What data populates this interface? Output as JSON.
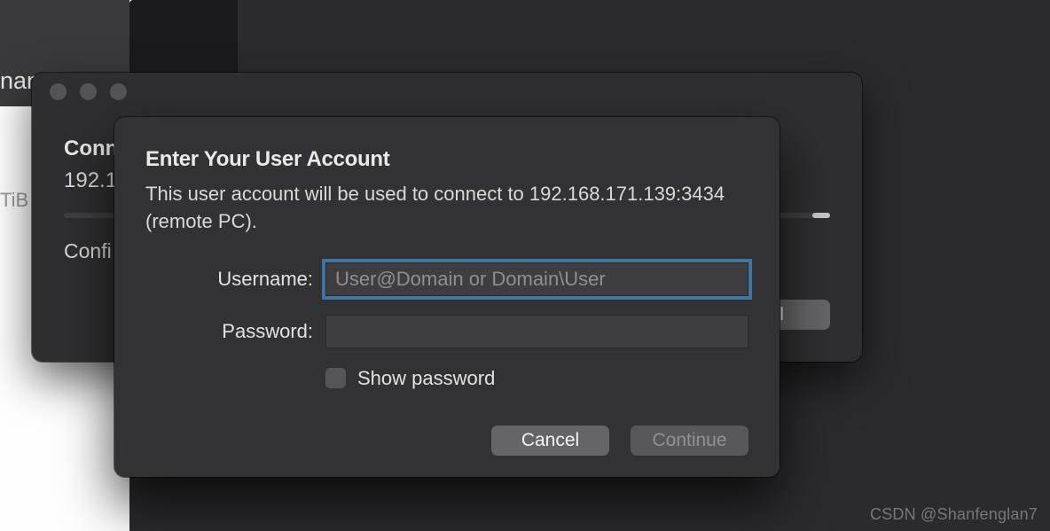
{
  "background": {
    "sidebar_text": "nan",
    "sidebar_label": "TiB"
  },
  "parent_window": {
    "title": "Conn",
    "ip": "192.1",
    "config": "Confi",
    "cancel_label": "el"
  },
  "modal": {
    "title": "Enter Your User Account",
    "description": "This user account will be used to connect to 192.168.171.139:3434 (remote PC).",
    "username_label": "Username:",
    "username_placeholder": "User@Domain or Domain\\User",
    "username_value": "",
    "password_label": "Password:",
    "password_value": "",
    "show_password_label": "Show password",
    "cancel_label": "Cancel",
    "continue_label": "Continue"
  },
  "watermark": "CSDN @Shanfenglan7"
}
